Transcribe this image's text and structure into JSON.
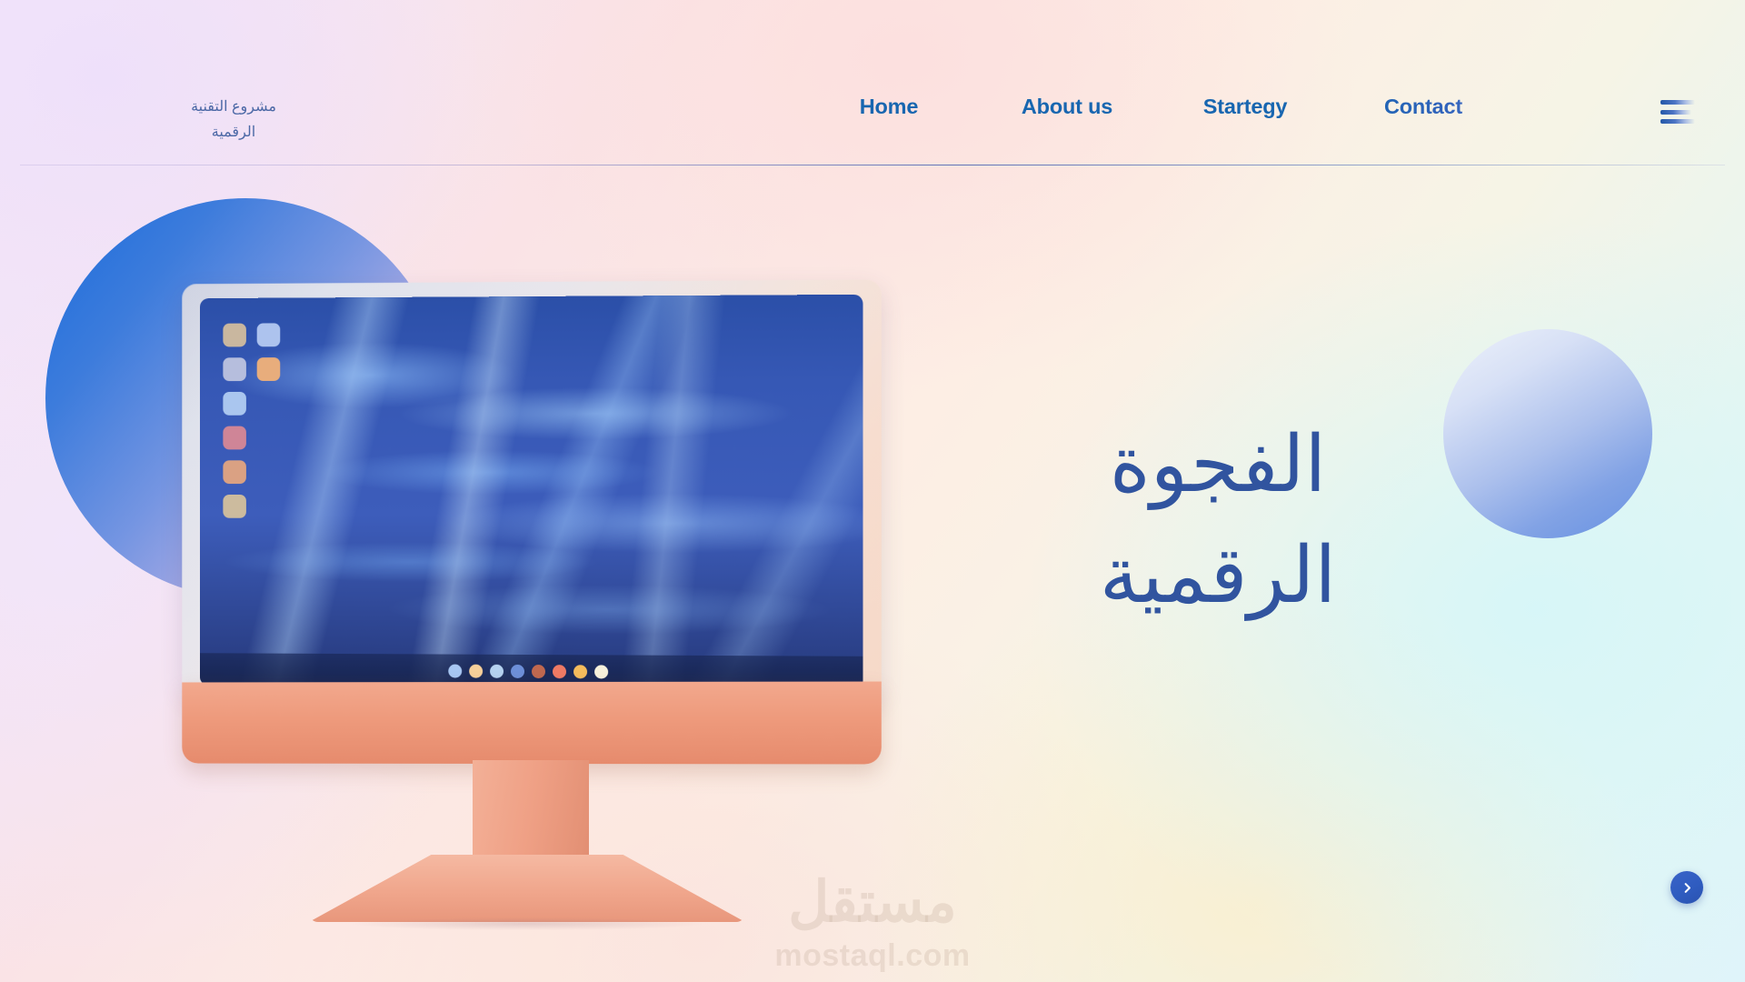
{
  "header": {
    "logo_line1": "مشروع التقنية",
    "logo_line2": "الرقمية",
    "nav": [
      {
        "label": "Home"
      },
      {
        "label": "About us"
      },
      {
        "label": "Startegy"
      },
      {
        "label": "Contact"
      }
    ],
    "menu_icon": "hamburger-icon"
  },
  "hero": {
    "headline_line1": "الفجوة",
    "headline_line2": "الرقمية",
    "next_icon": "chevron-right-icon"
  },
  "illustration": {
    "device": "imac-desktop-computer",
    "desktop_icons": [
      {
        "color": "#c9b79f"
      },
      {
        "color": "#adc3ee"
      },
      {
        "color": "#b6bedd"
      },
      {
        "color": "#e8ad7c"
      },
      {
        "color": "#aac6ef"
      },
      {
        "color": "#cf8597"
      },
      {
        "color": "#daa183"
      },
      {
        "color": "#ccbb9e"
      }
    ],
    "dock_dots": [
      {
        "color": "#a7c6f2"
      },
      {
        "color": "#f7d09a"
      },
      {
        "color": "#b5d2f0"
      },
      {
        "color": "#6d8fd8"
      },
      {
        "color": "#c0684f"
      },
      {
        "color": "#ef7a64"
      },
      {
        "color": "#f5bc5c"
      },
      {
        "color": "#f7f1dc"
      }
    ]
  },
  "watermark": {
    "arabic": "مستقل",
    "latin": "mostaql.com"
  },
  "colors": {
    "nav_blue": "#1866b0",
    "headline_blue": "#31549f",
    "logo_blue": "#3f5fa0",
    "accent_button": "#2f5cc0"
  }
}
